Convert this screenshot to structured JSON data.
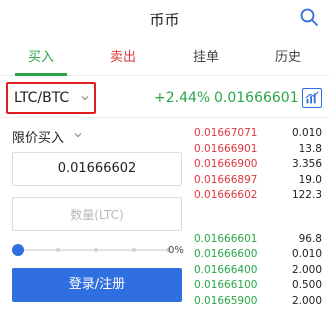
{
  "header": {
    "title": "币币",
    "search_icon": "search-icon"
  },
  "tabs": [
    {
      "label": "买入"
    },
    {
      "label": "卖出"
    },
    {
      "label": "挂单"
    },
    {
      "label": "历史"
    }
  ],
  "pair": {
    "name": "LTC/BTC",
    "change": "+2.44%",
    "last_price": "0.01666601",
    "chart_icon": "chart-icon"
  },
  "form": {
    "order_type": "限价买入",
    "price_value": "0.01666602",
    "qty_placeholder": "数量(LTC)",
    "slider_percent_label": "0%",
    "slider_value": 0,
    "submit_label": "登录/注册"
  },
  "asks": [
    {
      "price": "0.01667071",
      "qty": "0.010"
    },
    {
      "price": "0.01666901",
      "qty": "13.8"
    },
    {
      "price": "0.01666900",
      "qty": "3.356"
    },
    {
      "price": "0.01666897",
      "qty": "19.0"
    },
    {
      "price": "0.01666602",
      "qty": "122.3"
    }
  ],
  "bids": [
    {
      "price": "0.01666601",
      "qty": "96.8"
    },
    {
      "price": "0.01666600",
      "qty": "0.010"
    },
    {
      "price": "0.01666400",
      "qty": "2.000"
    },
    {
      "price": "0.01666100",
      "qty": "0.500"
    },
    {
      "price": "0.01665900",
      "qty": "2.000"
    }
  ],
  "colors": {
    "buy": "#27a745",
    "sell": "#e0383e",
    "accent": "#2f6fe0",
    "highlight": "#e01e1e"
  }
}
